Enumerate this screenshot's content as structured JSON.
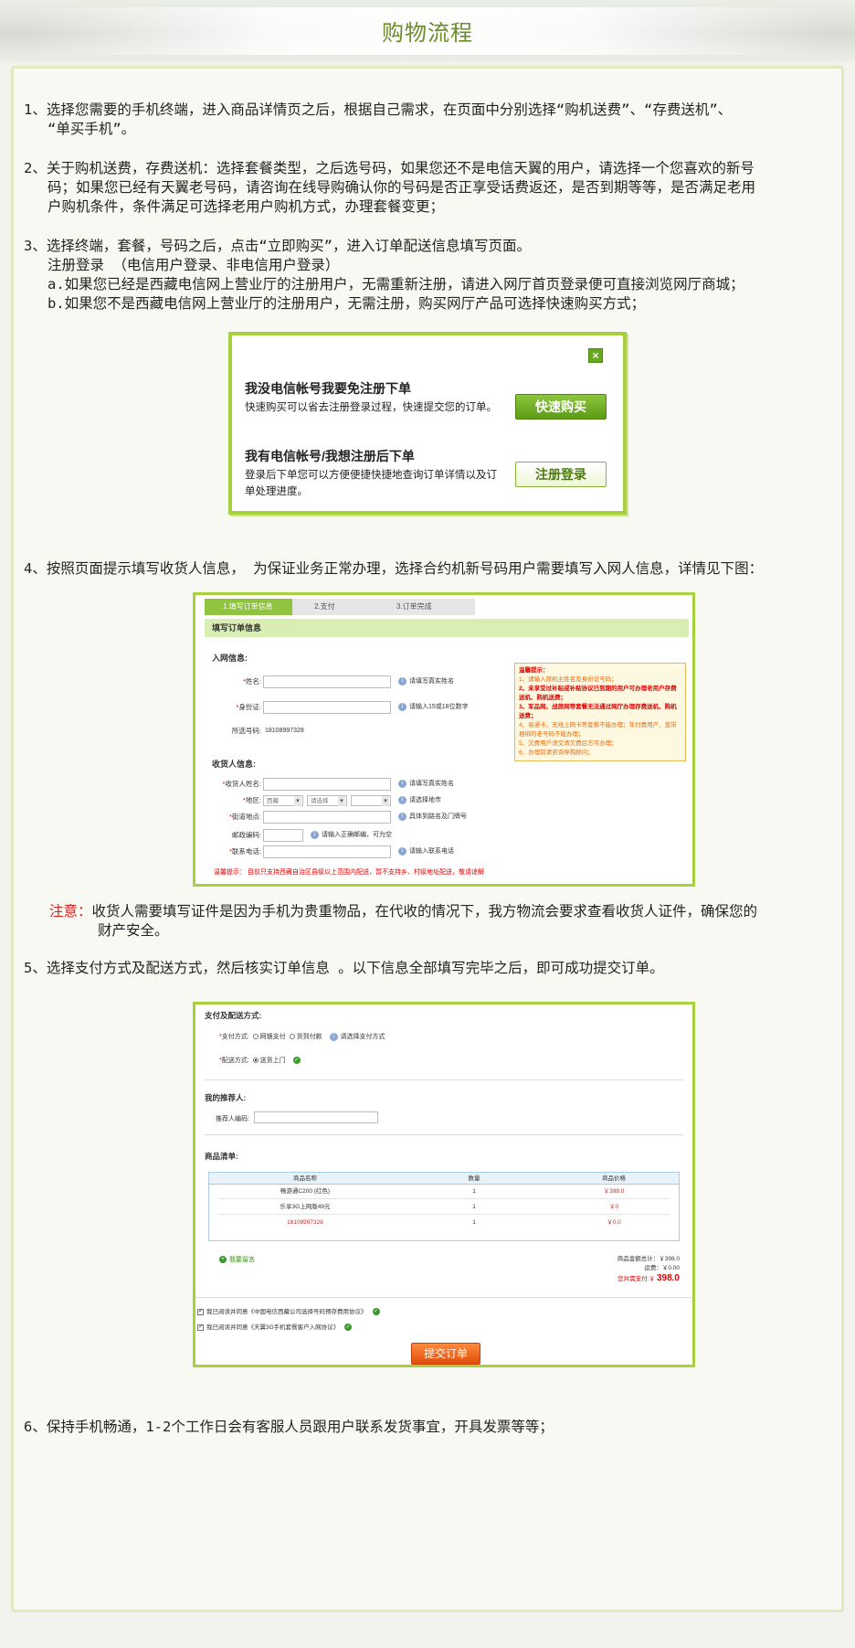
{
  "header": {
    "title": "购物流程"
  },
  "steps": {
    "s1": {
      "l1": "1、选择您需要的手机终端，进入商品详情页之后，根据自己需求，在页面中分别选择“购机送费”、“存费送机”、",
      "l2": "“单买手机”。"
    },
    "s2": {
      "l1": "2、关于购机送费，存费送机：选择套餐类型，之后选号码，如果您还不是电信天翼的用户，请选择一个您喜欢的新号",
      "l2": "码；如果您已经有天翼老号码，请咨询在线导购确认你的号码是否正享受话费返还，是否到期等等，是否满足老用",
      "l3": "户购机条件，条件满足可选择老用户购机方式，办理套餐变更；"
    },
    "s3": {
      "l1": "3、选择终端，套餐，号码之后，点击“立即购买”，进入订单配送信息填写页面。",
      "l2": "注册登录 （电信用户登录、非电信用户登录）",
      "l3": "a.如果您已经是西藏电信网上营业厅的注册用户，无需重新注册，请进入网厅首页登录便可直接浏览网厅商城；",
      "l4": "b.如果您不是西藏电信网上营业厅的注册用户，无需注册，购买网厅产品可选择快速购买方式；"
    },
    "s4": {
      "l1": "4、按照页面提示填写收货人信息， 为保证业务正常办理，选择合约机新号码用户需要填写入网人信息，详情见下图："
    },
    "note": {
      "label": "注意：",
      "l1": "收货人需要填写证件是因为手机为贵重物品，在代收的情况下，我方物流会要求查看收货人证件，确保您的",
      "l2": "财产安全。"
    },
    "s5": {
      "l1": "5、选择支付方式及配送方式，然后核实订单信息 。以下信息全部填写完毕之后，即可成功提交订单。"
    },
    "s6": {
      "l1": "6、保持手机畅通，1-2个工作日会有客服人员跟用户联系发货事宜，开具发票等等；"
    }
  },
  "login_dialog": {
    "close": "×",
    "opt1_title": "我没电信帐号我要免注册下单",
    "opt1_desc": "快速购买可以省去注册登录过程，快速提交您的订单。",
    "opt1_btn": "快速购买",
    "opt2_title": "我有电信帐号/我想注册后下单",
    "opt2_desc": "登录后下单您可以方便便捷快捷地查询订单详情以及订单处理进度。",
    "opt2_btn": "注册登录"
  },
  "order_form": {
    "tabs": [
      "1.填写订单信息",
      "2.支付",
      "3.订单完成"
    ],
    "bar": "填写订单信息",
    "sec1": "入网信息:",
    "name_label": "姓名:",
    "name_hint": "请填写真实姓名",
    "id_label": "身份证:",
    "id_hint": "请输入15或18位数字",
    "num_label": "所选号码:",
    "num_value": "18108997328",
    "tips_title": "温馨提示：",
    "tips": [
      "1、请输入原机主姓名及身份证号码；",
      "2、未享受过补贴或补贴协议已到期的用户可办理老用户存费送机、购机送费；",
      "3、军品网、战旅网等套餐无法通过网厅办理存费送机、购机送费；",
      "4、易通卡、无线上网卡等套餐不能办理；年付费用户、宽带捆绑的老号码不能办理；",
      "5、欠费用户须交清欠费后方可办理；",
      "6、办理前请咨询导购顾问；"
    ],
    "sec2": "收货人信息:",
    "rcv_label": "收货人姓名:",
    "rcv_hint": "请填写真实姓名",
    "area_label": "地区:",
    "area_sel1": "西藏",
    "area_sel2": "请选择",
    "area_sel3": "",
    "area_hint": "请选择地市",
    "addr_label": "街道地点:",
    "addr_hint": "具体到路名及门牌号",
    "zip_label": "邮政编码:",
    "zip_hint": "请输入正确邮编，可为空",
    "phone_label": "联系电话:",
    "phone_hint": "请输入联系电话",
    "warn": "温馨提示：  目前只支持西藏自治区县级以上范围内配送，暂不支持乡、村级地址配送，敬请谅解"
  },
  "payment": {
    "sec1": "支付及配送方式:",
    "pay_label": "支付方式:",
    "pay_opt1": "网银支付",
    "pay_opt2": "货到付款",
    "pay_hint": "请选择支付方式",
    "ship_label": "配送方式:",
    "ship_opt": "送货上门",
    "sec2": "我的推荐人:",
    "ref_label": "推荐人编码:",
    "sec3": "商品清单:",
    "cols": [
      "商品名称",
      "数量",
      "商品价格"
    ],
    "rows": [
      {
        "name": "畅游通C200 (红色)",
        "qty": "1",
        "price": "￥398.0"
      },
      {
        "name": "乐享3G上网版49元",
        "qty": "1",
        "price": "￥0"
      },
      {
        "name": "18108997328",
        "qty": "1",
        "price": "￥0.0"
      }
    ],
    "msg_link": "我要留言",
    "total_label": "商品金额总计：￥398.0",
    "freight_label": "运费：￥0.00",
    "pay_total_label": "您共需支付:￥",
    "pay_total_value": "398.0",
    "agree1": "我已阅读并同意《中国电信西藏公司选择号码预存费用协议》",
    "agree2": "我已阅读并同意《天翼3G手机套餐客户入网协议》",
    "submit": "提交订单"
  },
  "colors": {
    "accent": "#a7d13c",
    "title": "#6c8d2a",
    "note": "#d42020"
  }
}
